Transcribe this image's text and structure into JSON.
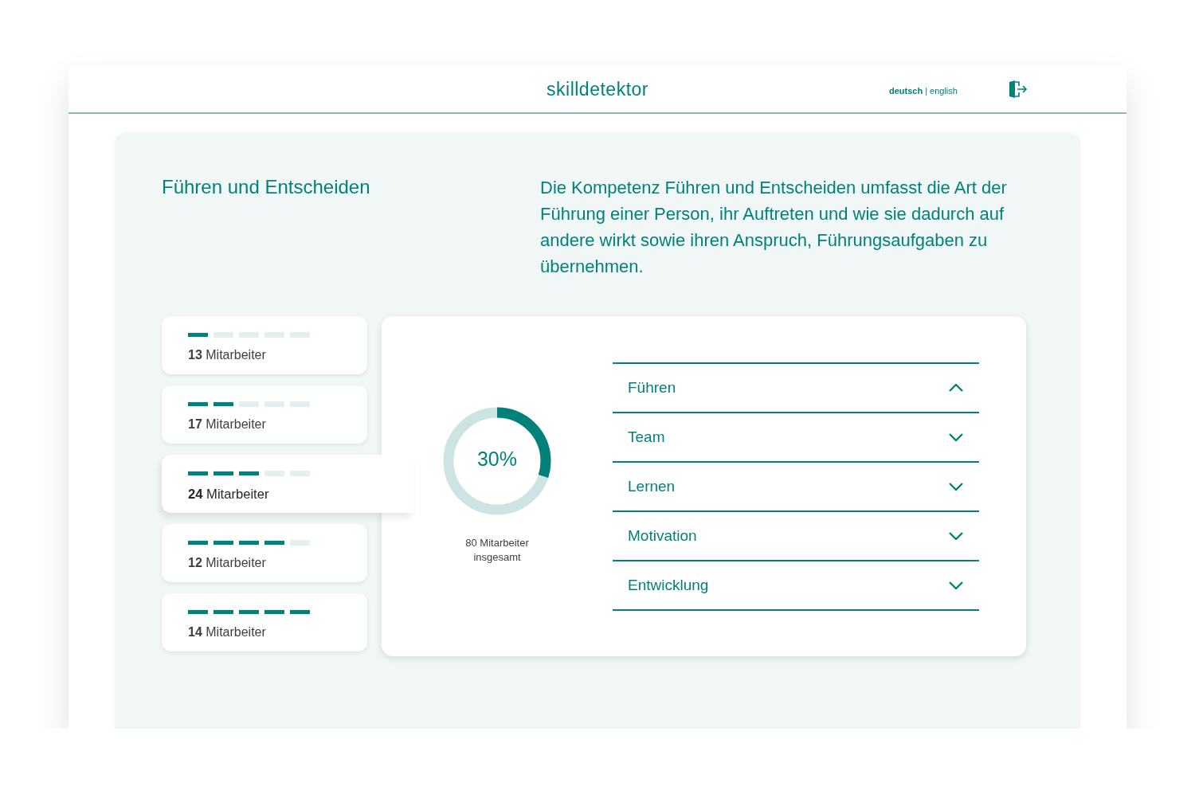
{
  "header": {
    "logo": "skilldetektor",
    "languages": [
      {
        "label": "deutsch",
        "selected": true
      },
      {
        "label": "english",
        "selected": false
      }
    ],
    "separator": "|"
  },
  "competence": {
    "title": "Führen und Entscheiden",
    "description": "Die Kompetenz Führen und Entscheiden umfasst die Art der Führung einer Person, ihr Auftreten und wie sie dadurch auf andere wirkt sowie ihren Anspruch, Führungsaufgaben zu übernehmen."
  },
  "levels": [
    {
      "count": "13",
      "label": "Mitarbeiter",
      "level": 0.2,
      "selected": false
    },
    {
      "count": "17",
      "label": "Mitarbeiter",
      "level": 0.4,
      "selected": false
    },
    {
      "count": "24",
      "label": "Mitarbeiter",
      "level": 0.6,
      "selected": true
    },
    {
      "count": "12",
      "label": "Mitarbeiter",
      "level": 0.8,
      "selected": false
    },
    {
      "count": "14",
      "label": "Mitarbeiter",
      "level": 1.0,
      "selected": false
    }
  ],
  "summary": {
    "percent": "30%",
    "level": 0.3,
    "caption": "80 Mitarbeiter insgesamt"
  },
  "accordion": [
    {
      "label": "Führen",
      "expanded": true
    },
    {
      "label": "Team",
      "expanded": false
    },
    {
      "label": "Lernen",
      "expanded": false
    },
    {
      "label": "Motivation",
      "expanded": false
    },
    {
      "label": "Entwicklung",
      "expanded": false
    }
  ]
}
